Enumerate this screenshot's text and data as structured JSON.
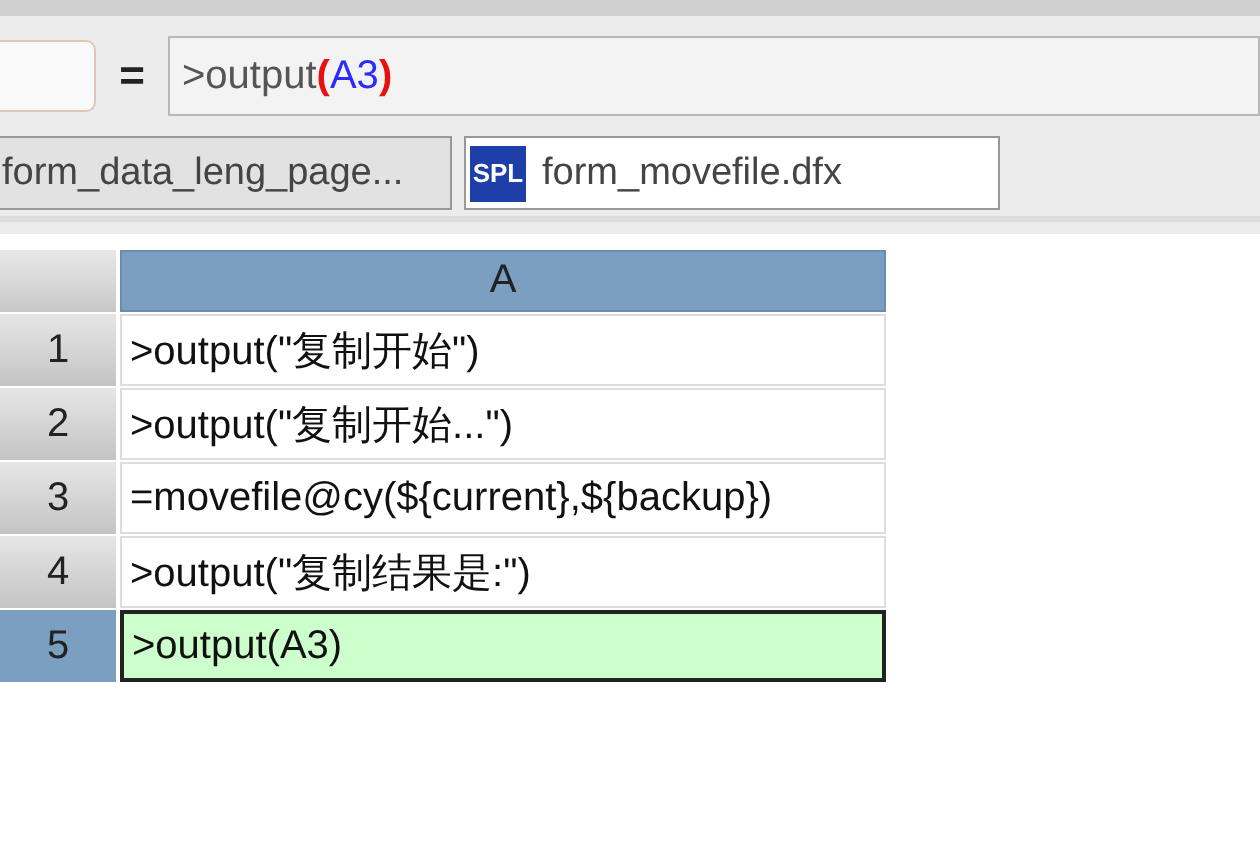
{
  "formula_bar": {
    "equals": "=",
    "parts": [
      {
        "text": ">output",
        "kind": "plain"
      },
      {
        "text": "(",
        "kind": "paren"
      },
      {
        "text": "A3",
        "kind": "ref"
      },
      {
        "text": ")",
        "kind": "paren"
      }
    ]
  },
  "tabs": [
    {
      "label": "form_data_leng_page...",
      "selected": false
    },
    {
      "label": "form_movefile.dfx",
      "selected": true,
      "badge": "SPL"
    }
  ],
  "grid": {
    "columns": [
      "A"
    ],
    "rows": [
      {
        "number": "1",
        "cell": ">output(\"复制开始\")",
        "selected": false
      },
      {
        "number": "2",
        "cell": ">output(\"复制开始...\")",
        "selected": false
      },
      {
        "number": "3",
        "cell": "=movefile@cy(${current},${backup})",
        "selected": false
      },
      {
        "number": "4",
        "cell": ">output(\"复制结果是:\")",
        "selected": false
      },
      {
        "number": "5",
        "cell": ">output(A3)",
        "selected": true
      }
    ]
  }
}
